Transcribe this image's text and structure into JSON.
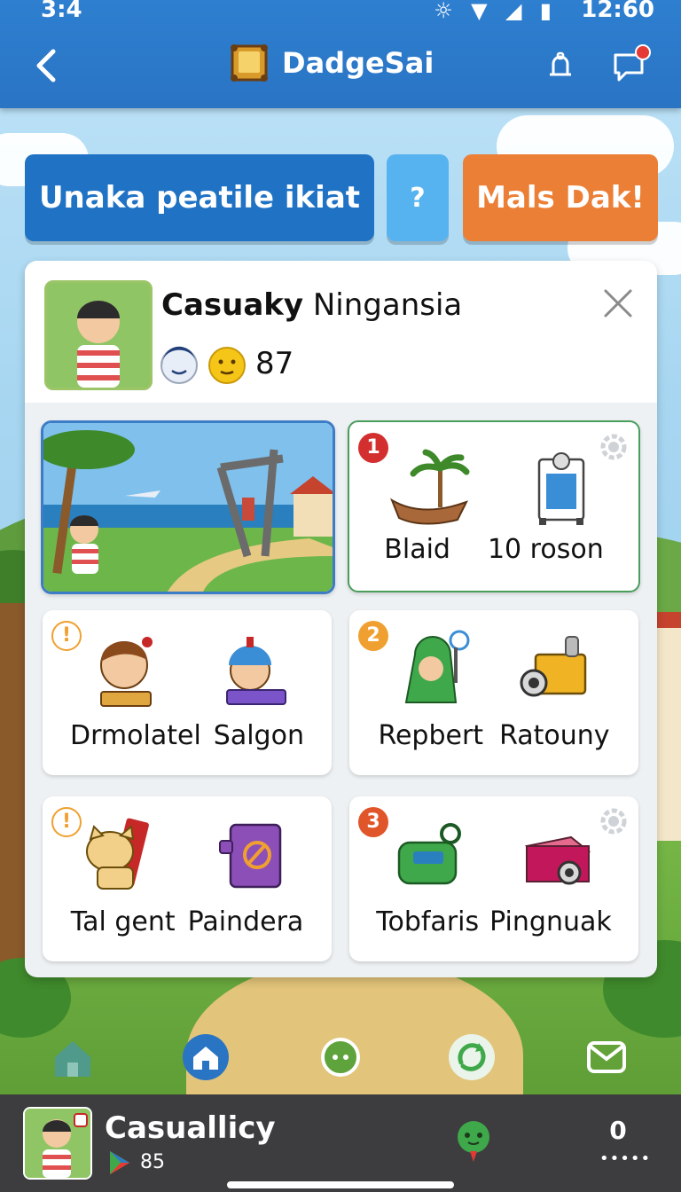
{
  "status_bar": {
    "time_left": "3:4",
    "time_right": "12:60"
  },
  "header": {
    "title": "DadgeSai"
  },
  "actions": {
    "main_label": "Unaka peatile ikiat",
    "help_label": "?",
    "cta_label": "Mals Dak!"
  },
  "player": {
    "name_bold": "Casuaky",
    "name_rest": " Ningansia",
    "score": "87"
  },
  "tiles": [
    {
      "labels": []
    },
    {
      "badge": "1",
      "labels": [
        "Blaid",
        "10 roson"
      ]
    },
    {
      "badge": "!",
      "labels": [
        "Drmolatel",
        "Salgon"
      ]
    },
    {
      "badge": "2",
      "labels": [
        "Repbert",
        "Ratouny"
      ]
    },
    {
      "badge": "!",
      "labels": [
        "Tal gent",
        "Paindera"
      ]
    },
    {
      "badge": "3",
      "labels": [
        "Tobfaris",
        "Pingnuak"
      ]
    }
  ],
  "profile_bar": {
    "name": "Casuallicy",
    "level": "85",
    "count": "0",
    "dots": "•••••"
  },
  "colors": {
    "appbar": "#2a74c4",
    "primary_button": "#1f72c4",
    "help_button": "#56b3f0",
    "cta_button": "#ec7f36",
    "badge_red": "#d32f2f",
    "badge_orange": "#f0a030",
    "badge_redorange": "#e0552a",
    "selected_tile_border": "#4a9e5c"
  },
  "icons": {
    "back": "back-arrow-icon",
    "logo": "treasure-book-icon",
    "bell": "bell-icon",
    "chat": "chat-icon",
    "close": "close-icon",
    "nav": [
      "home-icon",
      "home-active-icon",
      "circle-menu-icon",
      "refresh-icon",
      "mail-icon"
    ]
  }
}
